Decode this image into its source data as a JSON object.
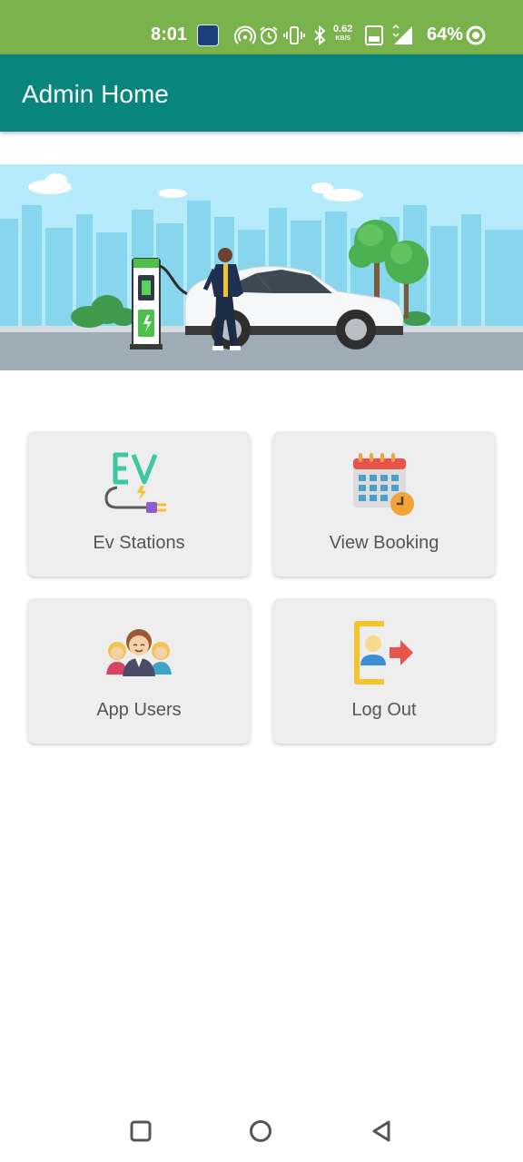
{
  "status_bar": {
    "time": "8:01",
    "speed_value": "0.62",
    "speed_unit": "KB/S",
    "battery": "64%",
    "icons": [
      "hotspot-icon",
      "alarm-icon",
      "vibrate-icon",
      "bluetooth-icon",
      "volte-icon",
      "signal-4g-icon",
      "battery-ring-icon"
    ]
  },
  "app_bar": {
    "title": "Admin Home",
    "color": "#08857c"
  },
  "banner": {
    "illustration": "ev-charging-car-illustration"
  },
  "menu": {
    "items": [
      {
        "label": "Ev Stations",
        "icon": "ev-plug-icon"
      },
      {
        "label": "View Booking",
        "icon": "calendar-clock-icon"
      },
      {
        "label": "App Users",
        "icon": "users-group-icon"
      },
      {
        "label": "Log Out",
        "icon": "logout-icon"
      }
    ]
  },
  "nav_bar": {
    "buttons": [
      "recents-button",
      "home-button",
      "back-button"
    ]
  },
  "colors": {
    "status_bar": "#7ab24b",
    "app_bar": "#08857c",
    "card_bg": "#eeeeee",
    "label": "#555555"
  }
}
